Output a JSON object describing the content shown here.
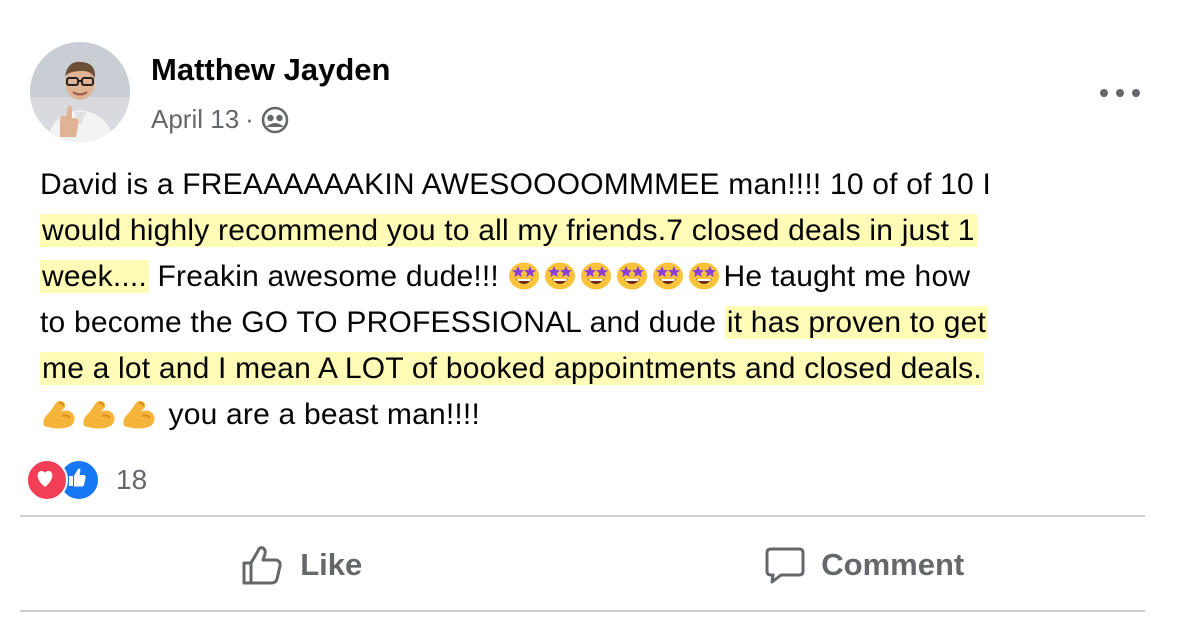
{
  "post": {
    "author": "Matthew Jayden",
    "date": "April 13",
    "separator": "·",
    "audience_icon": "friends-globe-icon",
    "more_icon": "more-options-icon",
    "lines": [
      {
        "plain": "David is a FREAAAAAAKIN AWESOOOOMMMEE man!!!! 10 of of 10 I"
      },
      {
        "highlight": "would highly recommend you to all my friends.7 closed deals in just 1"
      },
      {
        "highlight": "week....",
        "plain_after": " Freakin awesome dude!!!",
        "after_emoji": "He taught me how"
      },
      {
        "plain": "to become the GO TO PROFESSIONAL and dude",
        "highlight": "it has proven to get"
      },
      {
        "highlight": "me a lot and I mean A LOT of booked appointments and closed deals."
      },
      {
        "plain": "you are a beast man!!!!"
      }
    ],
    "emojis": {
      "star_struck_count": 6,
      "flexed_biceps_count": 3
    }
  },
  "reactions": {
    "icons": [
      "love-reaction-icon",
      "like-reaction-icon"
    ],
    "count": "18"
  },
  "actions": {
    "like_label": "Like",
    "comment_label": "Comment"
  },
  "colors": {
    "highlight": "#fdfbb6",
    "secondary_text": "#65676b",
    "love": "#f33e58",
    "like": "#1877f2"
  }
}
